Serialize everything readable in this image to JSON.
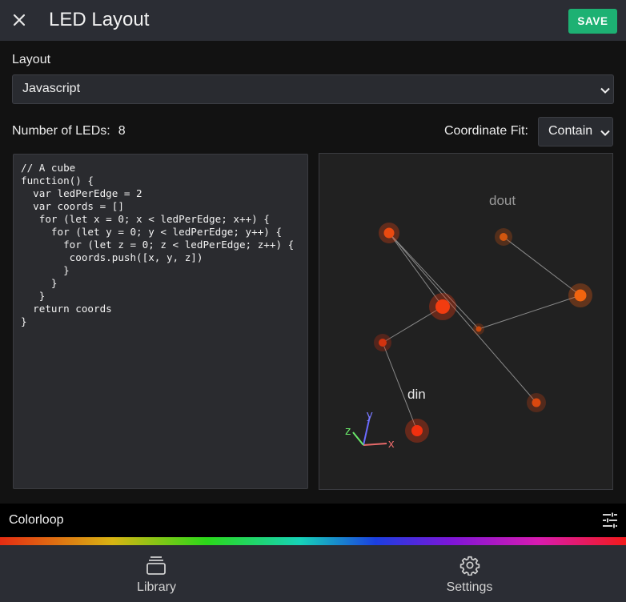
{
  "header": {
    "title": "LED Layout",
    "close_icon": "close-icon",
    "save_label": "SAVE",
    "save_color": "#1db173"
  },
  "layout": {
    "label": "Layout",
    "selected": "Javascript"
  },
  "leds": {
    "label": "Number of LEDs:",
    "count": "8"
  },
  "coordinate_fit": {
    "label": "Coordinate Fit:",
    "selected": "Contain"
  },
  "code": "// A cube\nfunction() {\n  var ledPerEdge = 2\n  var coords = []\n   for (let x = 0; x < ledPerEdge; x++) {\n     for (let y = 0; y < ledPerEdge; y++) {\n       for (let z = 0; z < ledPerEdge; z++) {\n        coords.push([x, y, z])\n       }\n     }\n   }\n  return coords\n}",
  "preview": {
    "din_label": "din",
    "dout_label": "dout",
    "axis_x": "x",
    "axis_y": "y",
    "axis_z": "z",
    "led_color": "#e83812",
    "wire_color": "#8a8a8a"
  },
  "pattern": {
    "name": "Colorloop",
    "settings_icon": "tune-icon"
  },
  "nav": {
    "library_label": "Library",
    "library_icon": "library-icon",
    "settings_label": "Settings",
    "settings_icon": "gear-icon"
  }
}
